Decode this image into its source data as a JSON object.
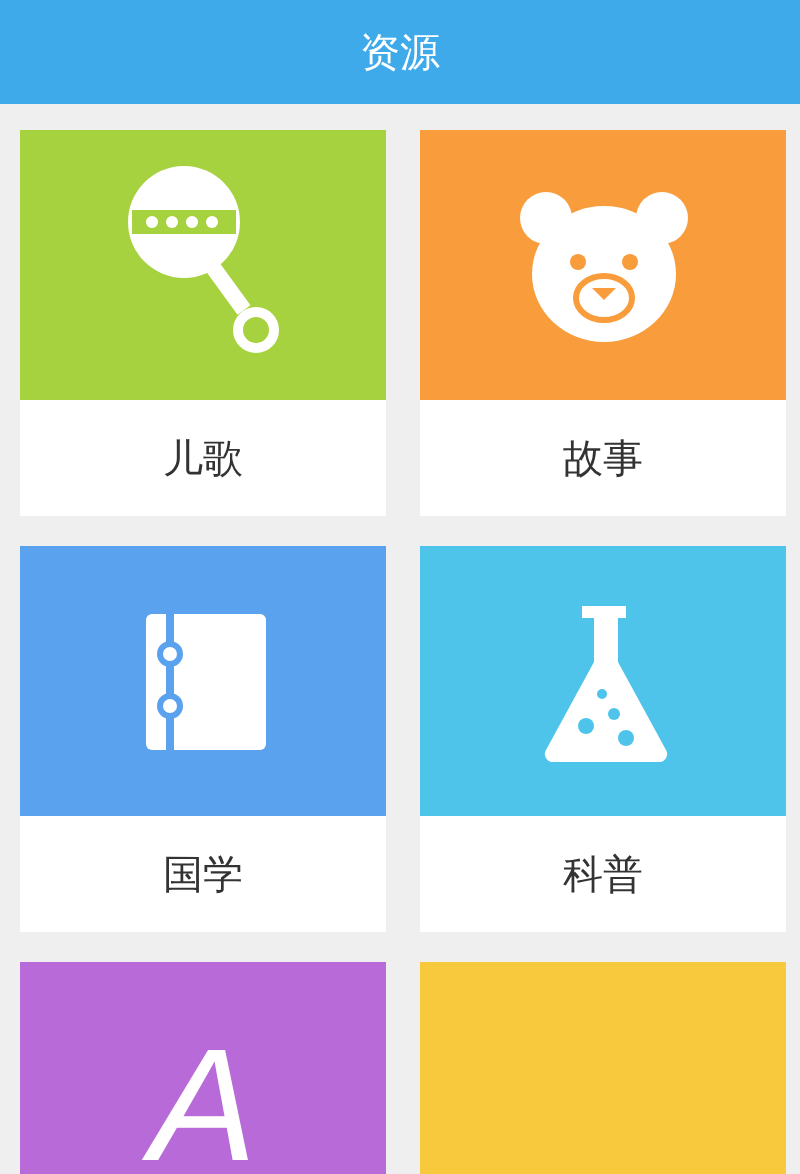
{
  "header": {
    "title": "资源"
  },
  "cards": [
    {
      "kind": "rattle",
      "color": "#a6d23f",
      "label": "儿歌"
    },
    {
      "kind": "bear",
      "color": "#f99c3b",
      "label": "故事"
    },
    {
      "kind": "notebook",
      "color": "#5aa2ee",
      "label": "国学"
    },
    {
      "kind": "flask",
      "color": "#4fc4ea",
      "label": "科普"
    },
    {
      "kind": "letter",
      "color": "#b86ad8",
      "glyph": "A"
    },
    {
      "kind": "blank",
      "color": "#f8c93c"
    }
  ]
}
